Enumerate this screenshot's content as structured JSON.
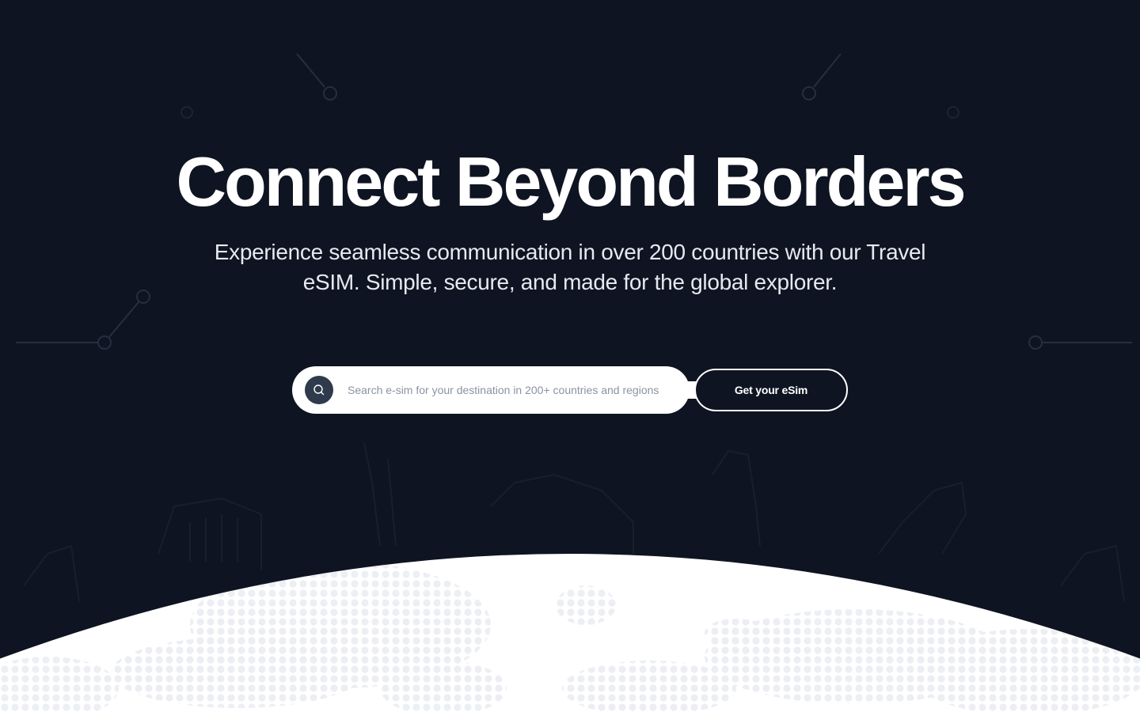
{
  "hero": {
    "title": "Connect Beyond Borders",
    "subtitle": "Experience seamless communication in over 200 countries with our Travel eSIM. Simple, secure, and made for the global explorer."
  },
  "search": {
    "icon": "search-icon",
    "placeholder": "Search e-sim for your destination in 200+ countries and regions",
    "value": ""
  },
  "cta": {
    "label": "Get your eSim"
  },
  "colors": {
    "background": "#0e1421",
    "globe": "#ffffff",
    "dots": "#e9ecf1",
    "search_icon_bg": "#2f3a4d",
    "placeholder": "#8b93a3"
  }
}
